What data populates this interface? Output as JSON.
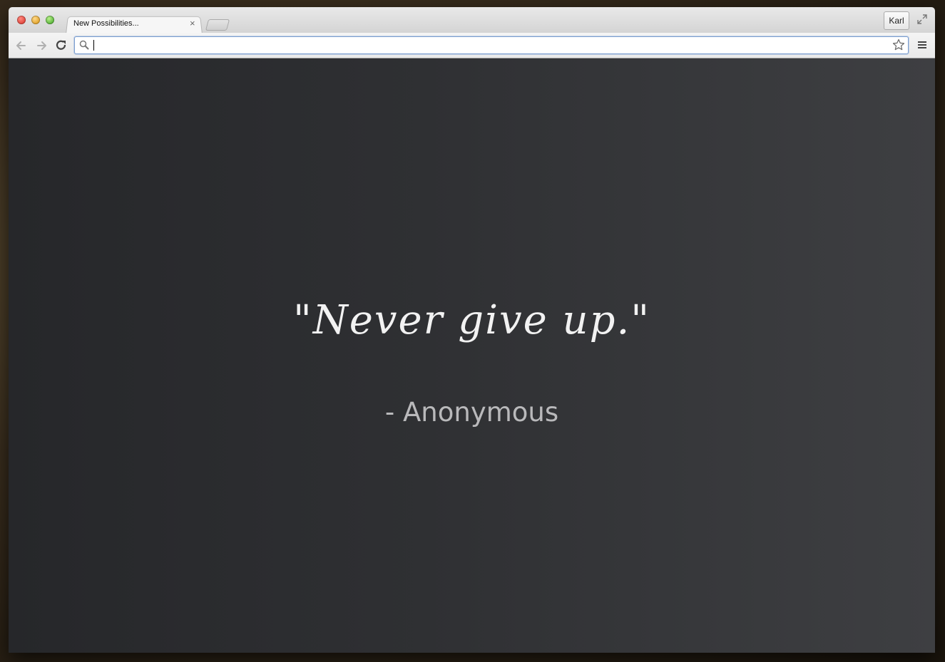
{
  "browser": {
    "tab": {
      "title": "New Possibilities...",
      "close_glyph": "×"
    },
    "profile_name": "Karl",
    "omnibox": {
      "value": "",
      "placeholder": ""
    },
    "icons": {
      "back": "back-arrow-icon",
      "forward": "forward-arrow-icon",
      "reload": "reload-icon",
      "search": "search-icon",
      "bookmark": "star-icon",
      "menu": "hamburger-menu-icon",
      "fullscreen": "fullscreen-icon"
    }
  },
  "page": {
    "quote": "\"Never give up.\"",
    "author": "- Anonymous"
  },
  "colors": {
    "content_bg_left": "#26272a",
    "content_bg_right": "#3e3f42",
    "quote_text": "#f2f2f2",
    "author_text": "#b9b9bb"
  }
}
